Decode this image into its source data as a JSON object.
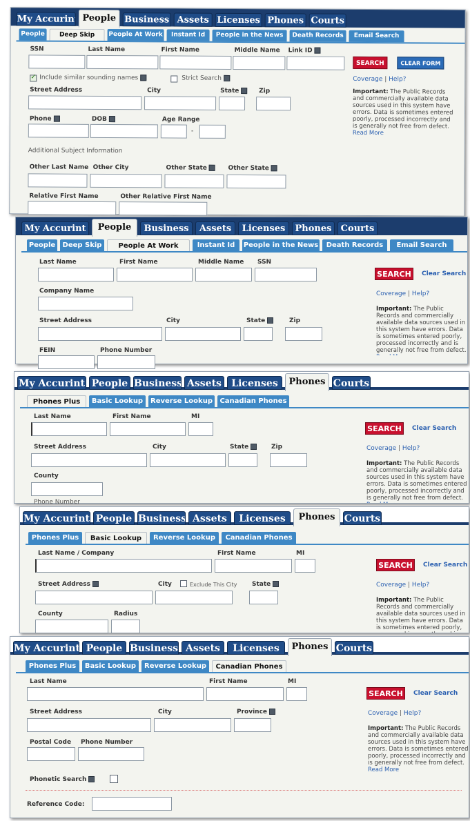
{
  "main_tabs": [
    "My Accurint",
    "People",
    "Business",
    "Assets",
    "Licenses",
    "Phones",
    "Courts"
  ],
  "common": {
    "search_label": "SEARCH",
    "clear_search": "Clear Search",
    "clear_form": "CLEAR FORM",
    "coverage": "Coverage",
    "help": "Help?",
    "important_label": "Important:",
    "important_text": "The Public Records and commercially available data sources used in this system have errors. Data is sometimes entered poorly, processed incorrectly and is generally not free from defect.",
    "read_more": "Read More"
  },
  "panel1": {
    "subtabs": [
      "People",
      "Deep Skip",
      "People At Work",
      "Instant Id",
      "People in the News",
      "Death Records",
      "Email Search"
    ],
    "labels": {
      "ssn": "SSN",
      "last_name": "Last Name",
      "first_name": "First Name",
      "middle_name": "Middle Name",
      "link_id": "Link ID",
      "similar": "Include similar sounding names",
      "strict": "Strict Search",
      "street": "Street Address",
      "city": "City",
      "state": "State",
      "zip": "Zip",
      "phone": "Phone",
      "dob": "DOB",
      "age_range": "Age Range",
      "additional": "Additional Subject Information",
      "other_last": "Other Last Name",
      "other_city": "Other City",
      "other_state1": "Other State",
      "other_state2": "Other State",
      "relative_first": "Relative First Name",
      "other_relative_first": "Other Relative First Name"
    }
  },
  "panel2": {
    "subtabs": [
      "People",
      "Deep Skip",
      "People At Work",
      "Instant Id",
      "People in the News",
      "Death Records",
      "Email Search"
    ],
    "labels": {
      "last_name": "Last Name",
      "first_name": "First Name",
      "middle_name": "Middle Name",
      "ssn": "SSN",
      "company": "Company Name",
      "street": "Street Address",
      "city": "City",
      "state": "State",
      "zip": "Zip",
      "fein": "FEIN",
      "phone": "Phone Number"
    }
  },
  "panel3": {
    "subtabs": [
      "Phones Plus",
      "Basic Lookup",
      "Reverse Lookup",
      "Canadian Phones"
    ],
    "labels": {
      "last_name": "Last Name",
      "first_name": "First Name",
      "mi": "MI",
      "street": "Street Address",
      "city": "City",
      "state": "State",
      "zip": "Zip",
      "county": "County",
      "phone": "Phone Number"
    }
  },
  "panel4": {
    "subtabs": [
      "Phones Plus",
      "Basic Lookup",
      "Reverse Lookup",
      "Canadian Phones"
    ],
    "labels": {
      "last_company": "Last Name / Company",
      "first_name": "First Name",
      "mi": "MI",
      "street": "Street Address",
      "city": "City",
      "exclude": "Exclude This City",
      "state": "State",
      "county": "County",
      "radius": "Radius"
    }
  },
  "panel5": {
    "subtabs": [
      "Phones Plus",
      "Basic Lookup",
      "Reverse Lookup",
      "Canadian Phones"
    ],
    "labels": {
      "last_name": "Last Name",
      "first_name": "First Name",
      "mi": "MI",
      "street": "Street Address",
      "city": "City",
      "province": "Province",
      "postal": "Postal Code",
      "phone": "Phone Number",
      "phonetic": "Phonetic Search",
      "reference": "Reference Code:"
    }
  }
}
